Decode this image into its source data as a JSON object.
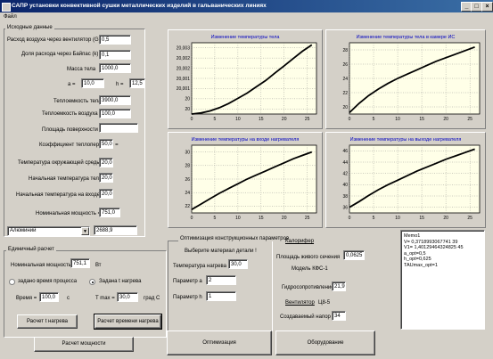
{
  "window": {
    "title": "САПР установки конвективной сушки металлических изделий в гальванических линиях",
    "minimize": "_",
    "maximize": "□",
    "close": "×"
  },
  "menu": {
    "file": "Файл"
  },
  "inputs": {
    "group_title": "Исходные данные",
    "airflow_label": "Расход воздуха через вентилятор (G) =",
    "airflow_value": "0,5",
    "bypass_label": "Доля расхода через Байпас (k) =",
    "bypass_value": "0,1",
    "mass_label": "Масса тела",
    "mass_value": "1000,0",
    "a_label": "a =",
    "a_value": "10,0",
    "h_label": "h =",
    "h_value": "12,5",
    "body_heat_cap_label": "Теплоемкость тела",
    "body_heat_cap_value": "3900,0",
    "air_heat_cap_label": "Теплоемкость воздуха",
    "air_heat_cap_value": "100,0",
    "surface_area_label": "Площадь поверхности",
    "surface_area_value": "",
    "heat_transfer_label": "Коэффициент теплопередачи =",
    "heat_transfer_value": "50,0",
    "ambient_temp_label": "Температура окружающей среды =",
    "ambient_temp_value": "20,0",
    "initial_body_temp_label": "Начальная температура тела =",
    "initial_body_temp_value": "20,0",
    "initial_inlet_temp_label": "Начальная температура на входе =",
    "initial_inlet_temp_value": "20,0",
    "nominal_power_label": "Номинальная мощность =",
    "nominal_power_value": "751,0",
    "material_selected": "Алюминий",
    "material_value": "2688,9"
  },
  "single_calc": {
    "group_title": "Единичный расчет",
    "nominal_power_label": "Номинальная мощность",
    "nominal_power_value": "751,1",
    "power_unit": "Вт",
    "radio_time": "задано время процесса",
    "radio_heating": "Задана t нагрева",
    "time_label": "Время =",
    "time_value": "100,0",
    "time_unit": "с",
    "tmax_label": "T max =",
    "tmax_value": "30,0",
    "tmax_unit": "град С",
    "calc_heating_button": "Расчет t нагрева",
    "calc_time_button": "Расчет времени нагрева",
    "calc_power_button": "Расчет мощности"
  },
  "optimization": {
    "group_title": "Оптимизация конструкционных параметров",
    "choose_material_label": "Выберите материал детали !",
    "heating_temp_label": "Температура нагрева",
    "heating_temp_value": "30,0",
    "param_a_label": "Параметр a",
    "param_a_value": "2",
    "param_h_label": "Параметр h",
    "param_h_value": "1"
  },
  "calorifer": {
    "title": "Калорифер",
    "live_section_label": "Площадь живого сечения",
    "live_section_value": "0,0625",
    "model_label": "Модель КФС-1",
    "hydraulic_resistance_label": "Гидросопротивление",
    "hydraulic_resistance_value": "21,9",
    "fan_label": "Вентилятор",
    "fan_model": "Ц8-5",
    "pressure_label": "Создаваемый напор",
    "pressure_value": "34"
  },
  "buttons": {
    "optimization": "Оптимизация",
    "equipment": "Оборудование"
  },
  "memo": {
    "lines": [
      "Memo1",
      "V= 0,3718993067741 39",
      "V1= 1,40129464324825 45",
      "a_opt=0,5",
      "h_opt=0,625",
      "TAUmax_opt=1"
    ]
  },
  "chart_data": [
    {
      "type": "line",
      "title": "Изменение температуры тела",
      "x": [
        0,
        2,
        4,
        6,
        8,
        10,
        12,
        14,
        16,
        18,
        20,
        22,
        24,
        26
      ],
      "y": [
        19.9998,
        19.99985,
        19.99995,
        20.0001,
        20.0003,
        20.00055,
        20.0008,
        20.0011,
        20.0014,
        20.00175,
        20.0021,
        20.00245,
        20.0028,
        20.0031
      ],
      "xlim": [
        0,
        27
      ],
      "ylim": [
        19.9998,
        20.0032
      ],
      "xticks": [
        "0",
        "5",
        "10",
        "15",
        "20",
        "25"
      ],
      "yticks": [
        "20,003",
        "20,002",
        "20,002",
        "20,001",
        "20,001",
        "20",
        "20"
      ],
      "grid": true
    },
    {
      "type": "line",
      "title": "Изменение температуры тела в камере ИС",
      "x": [
        0,
        2,
        4,
        6,
        8,
        10,
        12,
        14,
        16,
        18,
        20,
        22,
        24,
        26
      ],
      "y": [
        20.2,
        21.5,
        22.6,
        23.5,
        24.3,
        25.0,
        25.6,
        26.2,
        26.8,
        27.4,
        27.9,
        28.4,
        28.9,
        29.4
      ],
      "xlim": [
        0,
        27
      ],
      "ylim": [
        20,
        30
      ],
      "xticks": [
        "0",
        "5",
        "10",
        "15",
        "20",
        "25"
      ],
      "yticks": [
        "28",
        "26",
        "24",
        "22",
        "20"
      ],
      "grid": true
    },
    {
      "type": "line",
      "title": "Изменение температуры на входе нагревателя",
      "x": [
        0,
        2,
        4,
        6,
        8,
        10,
        12,
        14,
        16,
        18,
        20,
        22,
        24,
        26
      ],
      "y": [
        22.0,
        22.8,
        23.6,
        24.4,
        25.1,
        25.8,
        26.5,
        27.1,
        27.7,
        28.3,
        28.9,
        29.5,
        30.0,
        30.5
      ],
      "xlim": [
        0,
        27
      ],
      "ylim": [
        21.5,
        31.5
      ],
      "xticks": [
        "0",
        "5",
        "10",
        "15",
        "20",
        "25"
      ],
      "yticks": [
        "30",
        "28",
        "26",
        "24",
        "22"
      ],
      "grid": true
    },
    {
      "type": "line",
      "title": "Изменение температуры на выходе нагревателя",
      "x": [
        0,
        2,
        4,
        6,
        8,
        10,
        12,
        14,
        16,
        18,
        20,
        22,
        24,
        26
      ],
      "y": [
        36.5,
        37.5,
        38.6,
        39.6,
        40.5,
        41.3,
        42.1,
        42.9,
        43.6,
        44.3,
        45.0,
        45.6,
        46.2,
        46.8
      ],
      "xlim": [
        0,
        27
      ],
      "ylim": [
        35.5,
        47.5
      ],
      "xticks": [
        "0",
        "5",
        "10",
        "15",
        "20",
        "25"
      ],
      "yticks": [
        "46",
        "44",
        "42",
        "40",
        "38",
        "36"
      ],
      "grid": true
    }
  ]
}
